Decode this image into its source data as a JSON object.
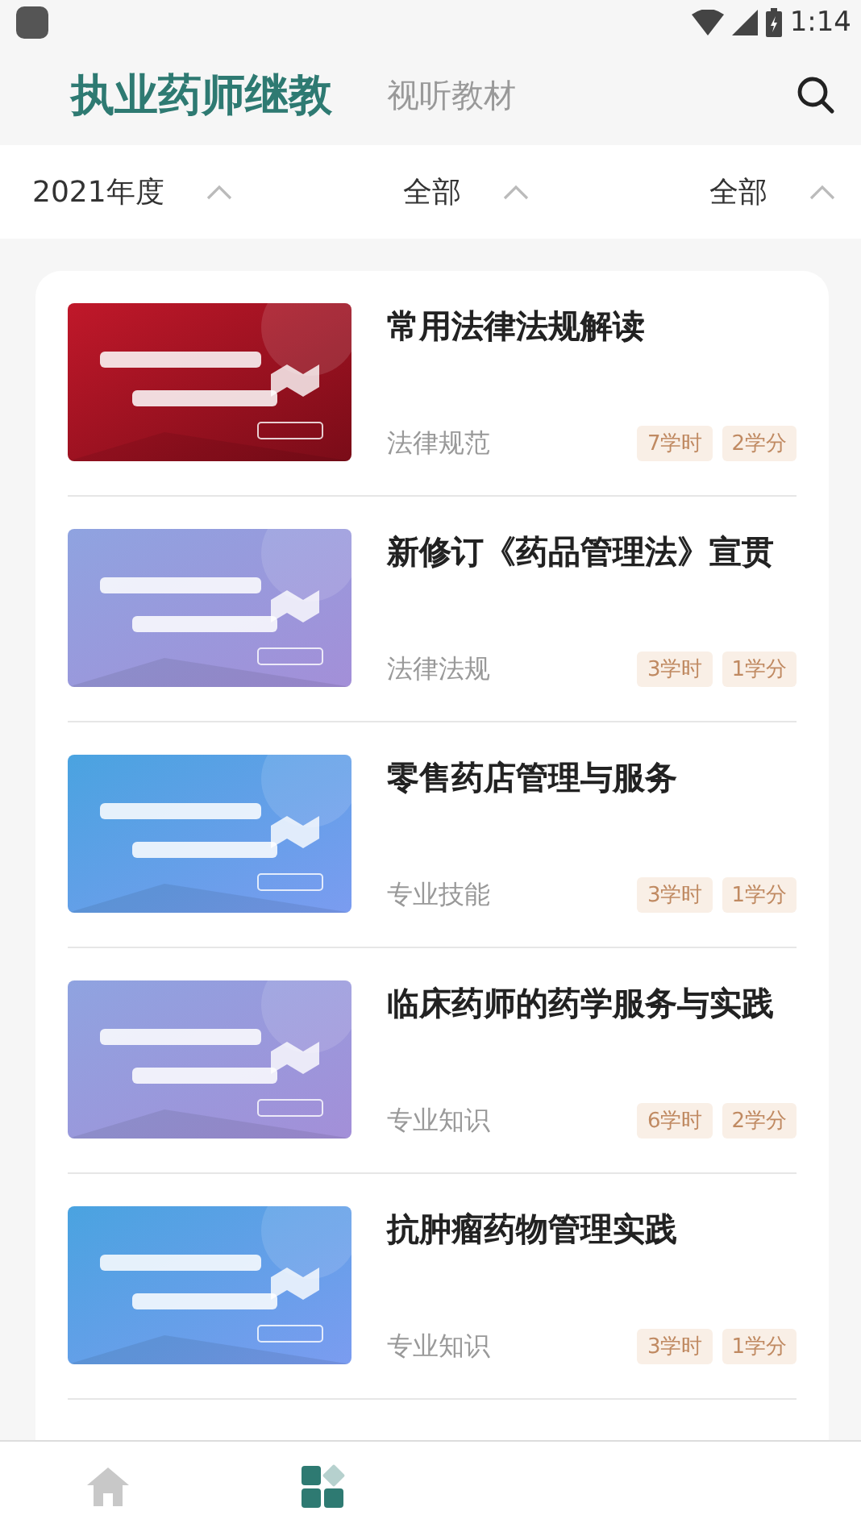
{
  "status_bar": {
    "time": "1:14"
  },
  "header": {
    "tabs": [
      {
        "label": "执业药师继教",
        "selected": true
      },
      {
        "label": "视听教材",
        "selected": false
      }
    ]
  },
  "filters": [
    {
      "label": "2021年度",
      "expanded": false
    },
    {
      "label": "全部",
      "expanded": false
    },
    {
      "label": "全部",
      "expanded": false
    }
  ],
  "courses": [
    {
      "title": "常用法律法规解读",
      "category": "法律规范",
      "hours": "7学时",
      "credits": "2学分"
    },
    {
      "title": "新修订《药品管理法》宣贯",
      "category": "法律法规",
      "hours": "3学时",
      "credits": "1学分"
    },
    {
      "title": "零售药店管理与服务",
      "category": "专业技能",
      "hours": "3学时",
      "credits": "1学分"
    },
    {
      "title": "临床药师的药学服务与实践",
      "category": "专业知识",
      "hours": "6学时",
      "credits": "2学分"
    },
    {
      "title": "抗肿瘤药物管理实践",
      "category": "专业知识",
      "hours": "3学时",
      "credits": "1学分"
    }
  ],
  "bottom_nav": [
    {
      "kind": "home",
      "selected": false
    },
    {
      "kind": "grid",
      "selected": true
    }
  ]
}
